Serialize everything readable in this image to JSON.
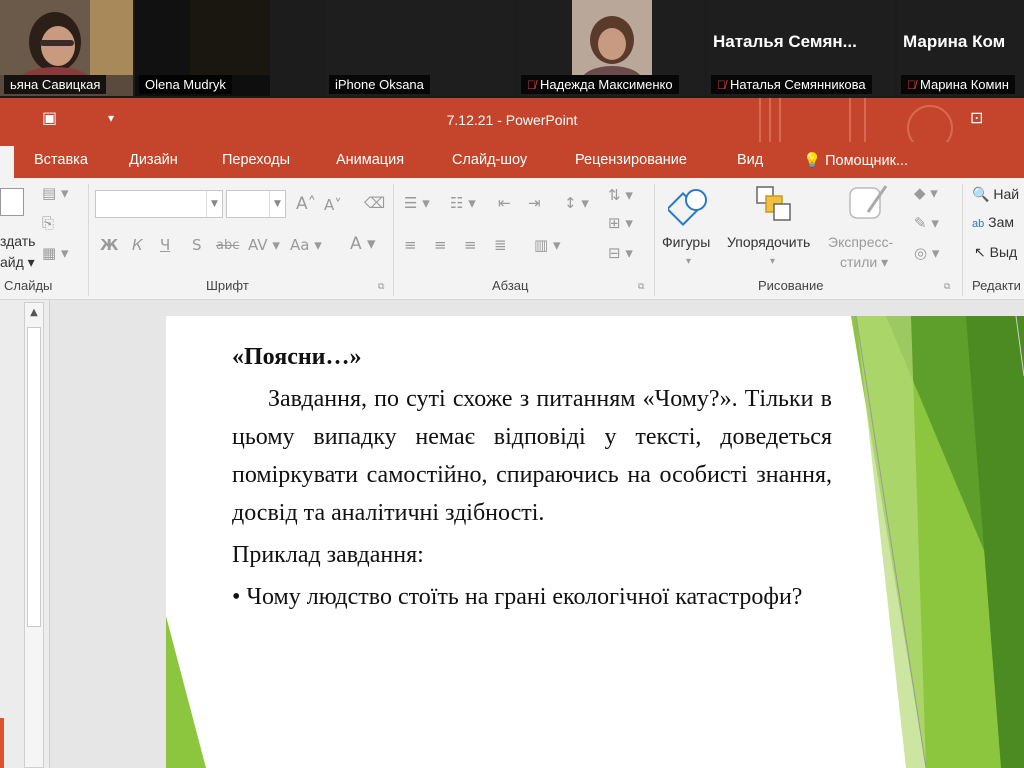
{
  "participants": [
    {
      "name": "ьяна Савицкая",
      "muted": false
    },
    {
      "name": "Olena Mudryk",
      "muted": false
    },
    {
      "name": "iPhone Oksana",
      "muted": false
    },
    {
      "name": "Надежда Максименко",
      "muted": true
    },
    {
      "name": "Наталья Семянникова",
      "muted": true,
      "big_name": "Наталья Семян..."
    },
    {
      "name": "Марина Комин",
      "muted": true,
      "big_name": "Марина Ком"
    }
  ],
  "window": {
    "title": "7.12.21 - PowerPoint"
  },
  "tabs": [
    "Вставка",
    "Дизайн",
    "Переходы",
    "Анимация",
    "Слайд-шоу",
    "Рецензирование",
    "Вид",
    "Помощник..."
  ],
  "ribbon": {
    "slides_group": {
      "label": "Слайды",
      "new_slide_line1": "здать",
      "new_slide_line2": "айд"
    },
    "font_group": {
      "label": "Шрифт",
      "bold": "Ж",
      "italic": "К",
      "underline": "Ч",
      "shadow": "S",
      "strike": "abc",
      "spacing": "AV",
      "case": "Aa",
      "color": "A",
      "grow": "A",
      "shrink": "A"
    },
    "paragraph_group": {
      "label": "Абзац"
    },
    "drawing_group": {
      "label": "Рисование",
      "shapes": "Фигуры",
      "arrange": "Упорядочить",
      "styles_line1": "Экспресс-",
      "styles_line2": "стили"
    },
    "editing_group": {
      "label": "Редакти",
      "find": "Най",
      "replace": "Зам",
      "select": "Выд"
    }
  },
  "slide": {
    "heading": "«Поясни…»",
    "paragraph": "Завдання, по суті схоже з питанням «Чому?». Тільки в цьому випадку немає відповіді у тексті,  доведеться поміркувати самостійно, спираючись на особисті знання, досвід та аналітичні здібності.",
    "example_label": "Приклад завдання:",
    "bullet": "• Чому людство стоїть на грані екологічної катастрофи?"
  },
  "colors": {
    "accent": "#c4452b",
    "slide_green": "#8cc63f"
  }
}
